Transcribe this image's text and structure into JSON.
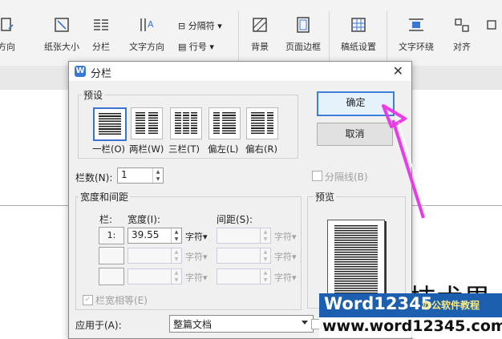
{
  "ribbon": {
    "items": [
      {
        "label": "方向",
        "icon": "orientation-icon"
      },
      {
        "label": "纸张大小",
        "icon": "paper-size-icon"
      },
      {
        "label": "分栏",
        "icon": "columns-icon"
      },
      {
        "label": "文字方向",
        "icon": "text-direction-icon"
      },
      {
        "label": "背景",
        "icon": "background-icon"
      },
      {
        "label": "页面边框",
        "icon": "page-border-icon"
      },
      {
        "label": "稿纸设置",
        "icon": "manuscript-icon"
      },
      {
        "label": "文字环绕",
        "icon": "text-wrap-icon"
      },
      {
        "label": "对齐",
        "icon": "align-icon"
      }
    ],
    "separator_label": "分隔符",
    "line_number_label": "行号"
  },
  "dialog": {
    "title": "分栏",
    "presets": {
      "group_label": "预设",
      "options": [
        "一栏(O)",
        "两栏(W)",
        "三栏(T)",
        "偏左(L)",
        "偏右(R)"
      ],
      "selected": "一栏(O)"
    },
    "ok_label": "确定",
    "cancel_label": "取消",
    "column_count": {
      "label": "栏数(N):",
      "value": "1"
    },
    "divider": {
      "label": "分隔线(B)",
      "checked": false
    },
    "width_spacing": {
      "group_label": "宽度和间距",
      "col_header": "栏:",
      "width_header": "宽度(I):",
      "spacing_header": "间距(S):",
      "unit": "字符",
      "rows": [
        {
          "col": "1:",
          "width": "39.55",
          "spacing": ""
        },
        {
          "col": "",
          "width": "",
          "spacing": ""
        },
        {
          "col": "",
          "width": "",
          "spacing": ""
        }
      ],
      "equal_width_label": "栏宽相等(E)"
    },
    "preview_label": "预览",
    "apply_to": {
      "label": "应用于(A):",
      "value": "整篇文档"
    }
  },
  "watermark": {
    "brand": "Word12345",
    "tagline": "办公软件教程",
    "url": "www.word12345.com"
  },
  "doc_text_fragment": "技术界",
  "colors": {
    "accent": "#3b73d1",
    "arrow": "#e83ce8"
  }
}
